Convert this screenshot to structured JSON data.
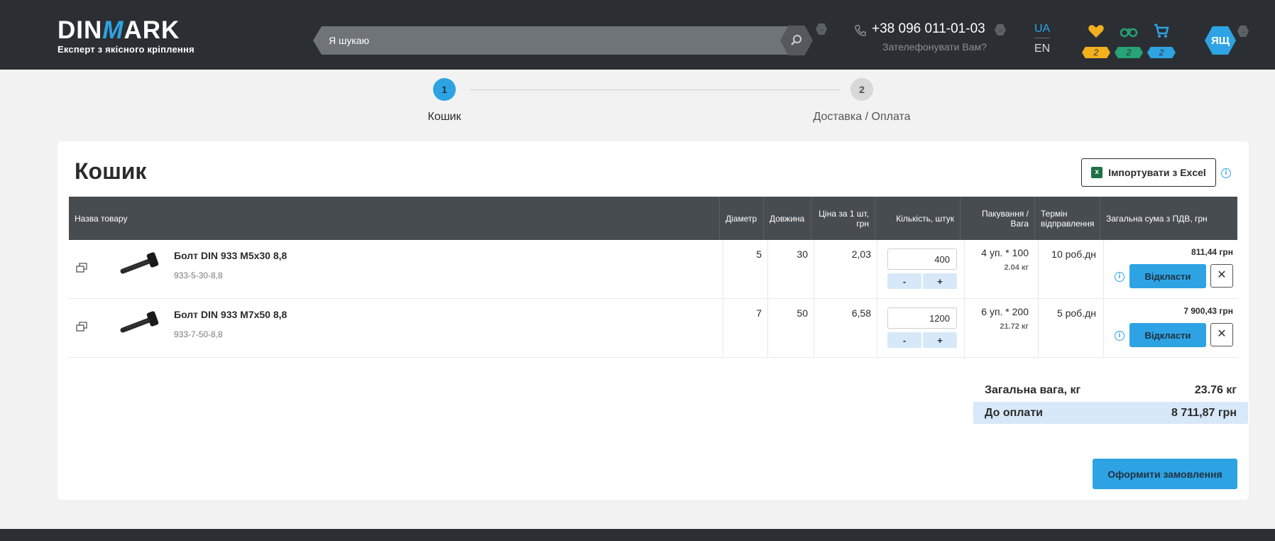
{
  "header": {
    "logo_text_a": "DIN",
    "logo_text_m": "M",
    "logo_text_b": "ARK",
    "logo_subtitle": "Експерт з якісного кріплення",
    "search_placeholder": "Я шукаю",
    "phone": "+38 096 011-01-03",
    "callback": "Зателефонувати Вам?",
    "lang_ua": "UA",
    "lang_en": "EN",
    "favorites_count": "2",
    "compare_count": "2",
    "cart_count": "2",
    "user_initials": "ЯЩ"
  },
  "steps": [
    {
      "number": "1",
      "label": "Кошик"
    },
    {
      "number": "2",
      "label": "Доставка / Оплата"
    }
  ],
  "cart": {
    "title": "Кошик",
    "import_label": "Імпортувати з Excel",
    "columns": {
      "name": "Назва товару",
      "diameter": "Діаметр",
      "length": "Довжина",
      "price": "Ціна за 1 шт, грн",
      "quantity": "Кількість, штук",
      "packaging": "Пакування / Вага",
      "term": "Термін відправлення",
      "total": "Загальна сума з ПДВ, грн"
    },
    "items": [
      {
        "name": "Болт DIN 933 M5x30 8,8",
        "code": "933-5-30-8,8",
        "diameter": "5",
        "length": "30",
        "price": "2,03",
        "quantity": "400",
        "packaging": "4 уп. * 100",
        "weight": "2.04 кг",
        "term": "10 роб.дн",
        "total": "811,44 грн"
      },
      {
        "name": "Болт DIN 933 M7x50 8,8",
        "code": "933-7-50-8,8",
        "diameter": "7",
        "length": "50",
        "price": "6,58",
        "quantity": "1200",
        "packaging": "6 уп. * 200",
        "weight": "21.72 кг",
        "term": "5 роб.дн",
        "total": "7 900,43 грн"
      }
    ],
    "minus": "-",
    "plus": "+",
    "postpone_label": "Відкласти",
    "remove_label": "✕",
    "weight_label": "Загальна вага, кг",
    "weight_value": "23.76 кг",
    "pay_label": "До оплати",
    "pay_value": "8 711,87 грн",
    "order_label": "Оформити замовлення"
  },
  "colors": {
    "accent": "#2ea3e3",
    "header_bg": "#2b2f33",
    "favorites_badge": "#f2b01e",
    "compare_badge": "#27a376",
    "cart_badge": "#2ea3e3"
  }
}
